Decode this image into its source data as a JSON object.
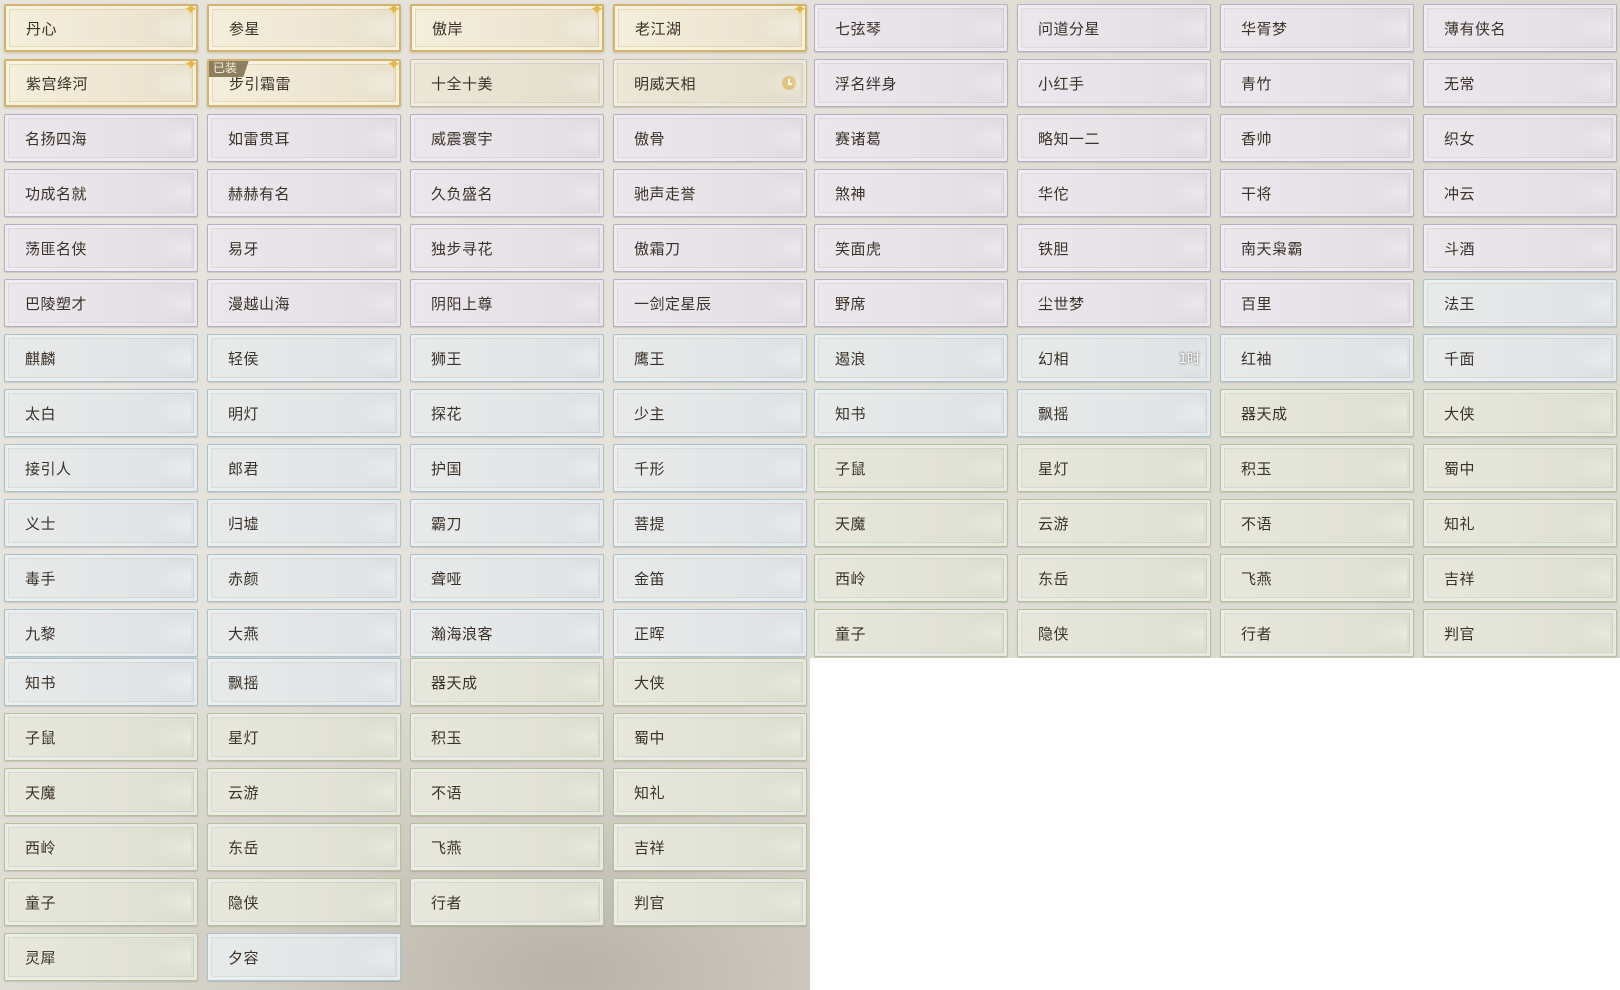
{
  "title_grid": {
    "rows": [
      [
        {
          "name": "丹心",
          "tier": "gold",
          "star": true
        },
        {
          "name": "参星",
          "tier": "gold",
          "star": true
        },
        {
          "name": "傲岸",
          "tier": "gold",
          "star": true
        },
        {
          "name": "老江湖",
          "tier": "gold",
          "star": true
        },
        {
          "name": "七弦琴",
          "tier": "purple"
        },
        {
          "name": "问道分星",
          "tier": "purple"
        },
        {
          "name": "华胥梦",
          "tier": "purple"
        },
        {
          "name": "薄有侠名",
          "tier": "purple"
        }
      ],
      [
        {
          "name": "紫宫绛河",
          "tier": "gold",
          "star": true
        },
        {
          "name": "步引霜雷",
          "tier": "gold",
          "star": true,
          "badge": "已装"
        },
        {
          "name": "十全十美",
          "tier": "tan"
        },
        {
          "name": "明威天相",
          "tier": "tan",
          "icon": "clock-icon"
        },
        {
          "name": "浮名绊身",
          "tier": "purple"
        },
        {
          "name": "小红手",
          "tier": "purple"
        },
        {
          "name": "青竹",
          "tier": "purple"
        },
        {
          "name": "无常",
          "tier": "purple"
        }
      ],
      [
        {
          "name": "名扬四海",
          "tier": "purple"
        },
        {
          "name": "如雷贯耳",
          "tier": "purple"
        },
        {
          "name": "威震寰宇",
          "tier": "purple"
        },
        {
          "name": "傲骨",
          "tier": "purple"
        },
        {
          "name": "赛诸葛",
          "tier": "purple"
        },
        {
          "name": "略知一二",
          "tier": "purple"
        },
        {
          "name": "香帅",
          "tier": "purple"
        },
        {
          "name": "织女",
          "tier": "purple"
        }
      ],
      [
        {
          "name": "功成名就",
          "tier": "purple"
        },
        {
          "name": "赫赫有名",
          "tier": "purple"
        },
        {
          "name": "久负盛名",
          "tier": "purple"
        },
        {
          "name": "驰声走誉",
          "tier": "purple"
        },
        {
          "name": "煞神",
          "tier": "purple"
        },
        {
          "name": "华佗",
          "tier": "purple"
        },
        {
          "name": "干将",
          "tier": "purple"
        },
        {
          "name": "冲云",
          "tier": "purple"
        }
      ],
      [
        {
          "name": "荡匪名侠",
          "tier": "purple"
        },
        {
          "name": "易牙",
          "tier": "purple"
        },
        {
          "name": "独步寻花",
          "tier": "purple"
        },
        {
          "name": "傲霜刀",
          "tier": "purple"
        },
        {
          "name": "笑面虎",
          "tier": "purple"
        },
        {
          "name": "铁胆",
          "tier": "purple"
        },
        {
          "name": "南天枭霸",
          "tier": "purple"
        },
        {
          "name": "斗酒",
          "tier": "purple"
        }
      ],
      [
        {
          "name": "巴陵塑才",
          "tier": "purple"
        },
        {
          "name": "漫越山海",
          "tier": "purple"
        },
        {
          "name": "阴阳上尊",
          "tier": "purple"
        },
        {
          "name": "一剑定星辰",
          "tier": "purple"
        },
        {
          "name": "野席",
          "tier": "purple"
        },
        {
          "name": "尘世梦",
          "tier": "purple"
        },
        {
          "name": "百里",
          "tier": "purple"
        },
        {
          "name": "法王",
          "tier": "blue"
        }
      ],
      [
        {
          "name": "麒麟",
          "tier": "blue"
        },
        {
          "name": "轻侯",
          "tier": "blue"
        },
        {
          "name": "狮王",
          "tier": "blue"
        },
        {
          "name": "鹰王",
          "tier": "blue"
        },
        {
          "name": "遏浪",
          "tier": "blue"
        },
        {
          "name": "幻相",
          "tier": "blue",
          "timer": "1时"
        },
        {
          "name": "红袖",
          "tier": "blue"
        },
        {
          "name": "千面",
          "tier": "blue"
        }
      ],
      [
        {
          "name": "太白",
          "tier": "blue"
        },
        {
          "name": "明灯",
          "tier": "blue"
        },
        {
          "name": "探花",
          "tier": "blue"
        },
        {
          "name": "少主",
          "tier": "blue"
        },
        {
          "name": "知书",
          "tier": "blue"
        },
        {
          "name": "飘摇",
          "tier": "blue"
        },
        {
          "name": "器天成",
          "tier": "green"
        },
        {
          "name": "大侠",
          "tier": "green"
        }
      ],
      [
        {
          "name": "接引人",
          "tier": "blue"
        },
        {
          "name": "郎君",
          "tier": "blue"
        },
        {
          "name": "护国",
          "tier": "blue"
        },
        {
          "name": "千形",
          "tier": "blue"
        },
        {
          "name": "子鼠",
          "tier": "green"
        },
        {
          "name": "星灯",
          "tier": "green"
        },
        {
          "name": "积玉",
          "tier": "green"
        },
        {
          "name": "蜀中",
          "tier": "green"
        }
      ],
      [
        {
          "name": "义士",
          "tier": "blue"
        },
        {
          "name": "归墟",
          "tier": "blue"
        },
        {
          "name": "霸刀",
          "tier": "blue"
        },
        {
          "name": "菩提",
          "tier": "blue"
        },
        {
          "name": "天魔",
          "tier": "green"
        },
        {
          "name": "云游",
          "tier": "green"
        },
        {
          "name": "不语",
          "tier": "green"
        },
        {
          "name": "知礼",
          "tier": "green"
        }
      ],
      [
        {
          "name": "毒手",
          "tier": "blue"
        },
        {
          "name": "赤颜",
          "tier": "blue"
        },
        {
          "name": "聋哑",
          "tier": "blue"
        },
        {
          "name": "金笛",
          "tier": "blue"
        },
        {
          "name": "西岭",
          "tier": "green"
        },
        {
          "name": "东岳",
          "tier": "green"
        },
        {
          "name": "飞燕",
          "tier": "green"
        },
        {
          "name": "吉祥",
          "tier": "green"
        }
      ],
      [
        {
          "name": "九黎",
          "tier": "blue"
        },
        {
          "name": "大燕",
          "tier": "blue"
        },
        {
          "name": "瀚海浪客",
          "tier": "blue"
        },
        {
          "name": "正晖",
          "tier": "blue"
        },
        {
          "name": "童子",
          "tier": "green"
        },
        {
          "name": "隐侠",
          "tier": "green"
        },
        {
          "name": "行者",
          "tier": "green"
        },
        {
          "name": "判官",
          "tier": "green"
        }
      ],
      [
        {
          "name": "知书",
          "tier": "blue"
        },
        {
          "name": "飘摇",
          "tier": "blue"
        },
        {
          "name": "器天成",
          "tier": "green"
        },
        {
          "name": "大侠",
          "tier": "green"
        }
      ],
      [
        {
          "name": "子鼠",
          "tier": "green"
        },
        {
          "name": "星灯",
          "tier": "green"
        },
        {
          "name": "积玉",
          "tier": "green"
        },
        {
          "name": "蜀中",
          "tier": "green"
        }
      ],
      [
        {
          "name": "天魔",
          "tier": "green"
        },
        {
          "name": "云游",
          "tier": "green"
        },
        {
          "name": "不语",
          "tier": "green"
        },
        {
          "name": "知礼",
          "tier": "green"
        }
      ],
      [
        {
          "name": "西岭",
          "tier": "green"
        },
        {
          "name": "东岳",
          "tier": "green"
        },
        {
          "name": "飞燕",
          "tier": "green"
        },
        {
          "name": "吉祥",
          "tier": "green"
        }
      ],
      [
        {
          "name": "童子",
          "tier": "green"
        },
        {
          "name": "隐侠",
          "tier": "green"
        },
        {
          "name": "行者",
          "tier": "green"
        },
        {
          "name": "判官",
          "tier": "green"
        }
      ],
      [
        {
          "name": "灵犀",
          "tier": "green"
        },
        {
          "name": "夕容",
          "tier": "blue"
        }
      ]
    ]
  },
  "tier_colors": {
    "gold": "#d2b46f",
    "tan": "#cdbd9a",
    "purple": "#b9acc4",
    "blue": "#a9c2cf",
    "green": "#b4c29c"
  }
}
